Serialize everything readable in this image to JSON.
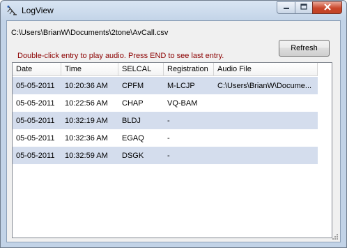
{
  "window": {
    "title": "LogView",
    "icons": {
      "app": "antenna-icon",
      "minimize": "minimize-icon",
      "maximize": "maximize-icon",
      "close": "close-icon"
    }
  },
  "file_path": "C:\\Users\\BrianW\\Documents\\2tone\\AvCall.csv",
  "hint": "Double-click entry to play audio. Press END to see last entry.",
  "refresh_label": "Refresh",
  "table": {
    "columns": [
      "Date",
      "Time",
      "SELCAL",
      "Registration",
      "Audio File"
    ],
    "rows": [
      {
        "date": "05-05-2011",
        "time": "10:20:36 AM",
        "selcal": "CPFM",
        "registration": "M-LCJP",
        "audio": "C:\\Users\\BrianW\\Docume..."
      },
      {
        "date": "05-05-2011",
        "time": "10:22:56 AM",
        "selcal": "CHAP",
        "registration": "VQ-BAM",
        "audio": ""
      },
      {
        "date": "05-05-2011",
        "time": "10:32:19 AM",
        "selcal": "BLDJ",
        "registration": "-",
        "audio": ""
      },
      {
        "date": "05-05-2011",
        "time": "10:32:36 AM",
        "selcal": "EGAQ",
        "registration": "-",
        "audio": ""
      },
      {
        "date": "05-05-2011",
        "time": "10:32:59 AM",
        "selcal": "DSGK",
        "registration": "-",
        "audio": ""
      }
    ]
  },
  "colors": {
    "hint": "#8b0000",
    "alt_row": "#d4dded",
    "close_button": "#c9462a"
  }
}
